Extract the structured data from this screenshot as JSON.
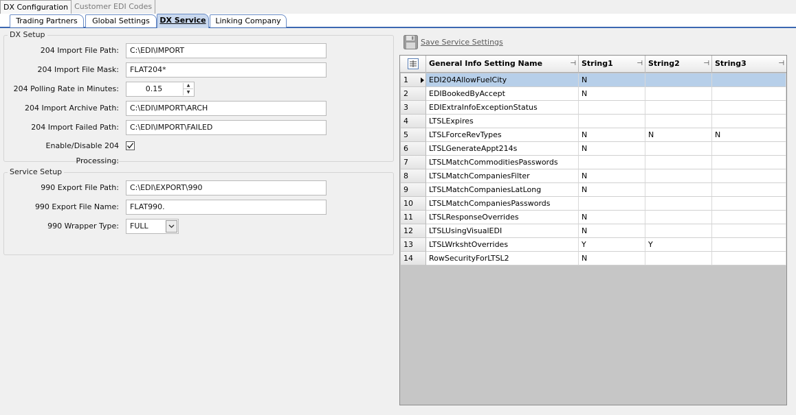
{
  "top_tabs": [
    {
      "label": "DX Configuration",
      "active": true
    },
    {
      "label": "Customer EDI Codes",
      "active": false
    }
  ],
  "sub_tabs": [
    {
      "label": "Trading Partners"
    },
    {
      "label": "Global Settings"
    },
    {
      "label": "DX Service",
      "active": true
    },
    {
      "label": "Linking Company"
    }
  ],
  "dx_setup": {
    "title": "DX Setup",
    "import_path_label": "204 Import File Path:",
    "import_path_value": "C:\\EDI\\IMPORT",
    "import_mask_label": "204 Import File Mask:",
    "import_mask_value": "FLAT204*",
    "polling_label": "204 Polling Rate in Minutes:",
    "polling_value": "0.15",
    "archive_label": "204 Import Archive Path:",
    "archive_value": "C:\\EDI\\IMPORT\\ARCH",
    "failed_label": "204 Import Failed Path:",
    "failed_value": "C:\\EDI\\IMPORT\\FAILED",
    "enable_label": "Enable/Disable 204 Processing:",
    "enable_checked": true
  },
  "service_setup": {
    "title": "Service Setup",
    "export_path_label": "990 Export File Path:",
    "export_path_value": "C:\\EDI\\EXPORT\\990",
    "export_name_label": "990 Export File Name:",
    "export_name_value": "FLAT990.",
    "wrapper_label": "990 Wrapper Type:",
    "wrapper_value": "FULL"
  },
  "save": {
    "label": "Save Service Settings",
    "icon": "floppy-disk-icon"
  },
  "grid": {
    "columns": [
      "General Info Setting Name",
      "String1",
      "String2",
      "String3"
    ],
    "rows": [
      {
        "num": "1",
        "name": "EDI204AllowFuelCity",
        "s1": "N",
        "s2": "",
        "s3": ""
      },
      {
        "num": "2",
        "name": "EDIBookedByAccept",
        "s1": "N",
        "s2": "",
        "s3": ""
      },
      {
        "num": "3",
        "name": "EDIExtraInfoExceptionStatus",
        "s1": "",
        "s2": "",
        "s3": ""
      },
      {
        "num": "4",
        "name": "LTSLExpires",
        "s1": "",
        "s2": "",
        "s3": ""
      },
      {
        "num": "5",
        "name": "LTSLForceRevTypes",
        "s1": "N",
        "s2": "N",
        "s3": "N"
      },
      {
        "num": "6",
        "name": "LTSLGenerateAppt214s",
        "s1": "N",
        "s2": "",
        "s3": ""
      },
      {
        "num": "7",
        "name": "LTSLMatchCommoditiesPasswords",
        "s1": "",
        "s2": "",
        "s3": ""
      },
      {
        "num": "8",
        "name": "LTSLMatchCompaniesFilter",
        "s1": "N",
        "s2": "",
        "s3": ""
      },
      {
        "num": "9",
        "name": "LTSLMatchCompaniesLatLong",
        "s1": "N",
        "s2": "",
        "s3": ""
      },
      {
        "num": "10",
        "name": "LTSLMatchCompaniesPasswords",
        "s1": "",
        "s2": "",
        "s3": ""
      },
      {
        "num": "11",
        "name": "LTSLResponseOverrides",
        "s1": "N",
        "s2": "",
        "s3": ""
      },
      {
        "num": "12",
        "name": "LTSLUsingVisualEDI",
        "s1": "N",
        "s2": "",
        "s3": ""
      },
      {
        "num": "13",
        "name": "LTSLWrkshtOverrides",
        "s1": "Y",
        "s2": "Y",
        "s3": ""
      },
      {
        "num": "14",
        "name": "RowSecurityForLTSL2",
        "s1": "N",
        "s2": "",
        "s3": ""
      }
    ]
  }
}
